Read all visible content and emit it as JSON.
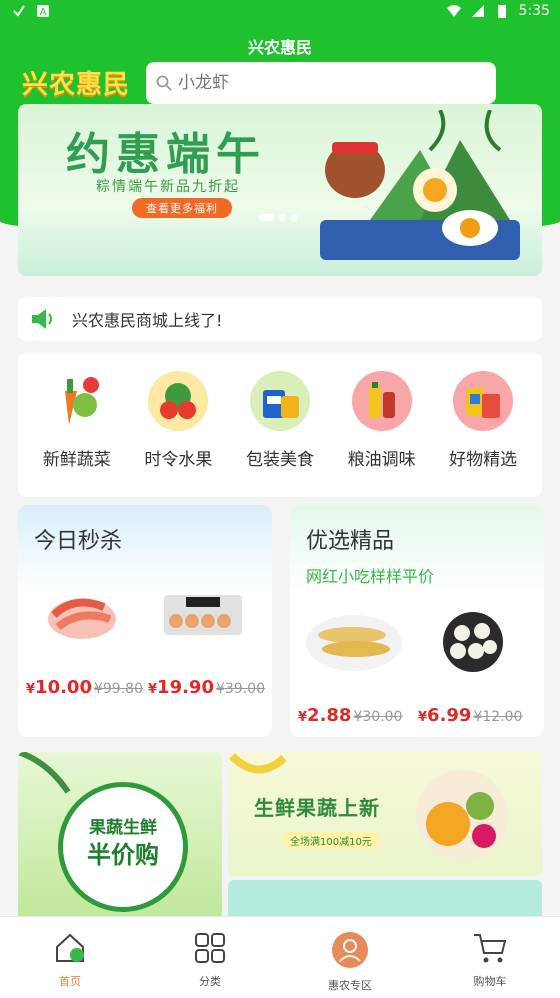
{
  "status_bar": {
    "time": "5:35"
  },
  "header": {
    "app_title": "兴农惠民",
    "logo_text": "兴农惠民"
  },
  "search": {
    "placeholder": "小龙虾"
  },
  "banner": {
    "title": "约惠端午",
    "subtitle": "粽情端午新品九折起",
    "button_label": "查看更多福利"
  },
  "notice": {
    "text": "兴农惠民商城上线了!"
  },
  "categories": [
    {
      "label": "新鲜蔬菜",
      "icon": "vegetables-icon"
    },
    {
      "label": "时令水果",
      "icon": "fruit-icon"
    },
    {
      "label": "包装美食",
      "icon": "packaged-food-icon"
    },
    {
      "label": "粮油调味",
      "icon": "grain-oil-icon"
    },
    {
      "label": "好物精选",
      "icon": "selected-goods-icon"
    }
  ],
  "flash_sale": {
    "title": "今日秒杀",
    "products": [
      {
        "name": "shrimp",
        "price": "10.00",
        "old_price": "¥99.80"
      },
      {
        "name": "eggs",
        "price": "19.90",
        "old_price": "¥39.00"
      }
    ]
  },
  "featured": {
    "title": "优选精品",
    "subtitle": "网红小吃样样平价",
    "products": [
      {
        "name": "yellow-croaker",
        "price": "2.88",
        "old_price": "¥30.00"
      },
      {
        "name": "scallops",
        "price": "6.99",
        "old_price": "¥12.00"
      }
    ]
  },
  "promo_left": {
    "line1": "果蔬生鲜",
    "line2": "半价购"
  },
  "promo_right": {
    "title": "生鲜果蔬上新",
    "tag": "全场满100减10元"
  },
  "currency": "¥",
  "tabbar": [
    {
      "label": "首页",
      "icon": "home-icon"
    },
    {
      "label": "分类",
      "icon": "grid-icon"
    },
    {
      "label": "惠农专区",
      "icon": "hui-nong-icon"
    },
    {
      "label": "购物车",
      "icon": "cart-icon"
    }
  ],
  "colors": {
    "brand_green": "#1fc12f",
    "price_red": "#e02a2a",
    "tab_active": "#e0823c"
  }
}
